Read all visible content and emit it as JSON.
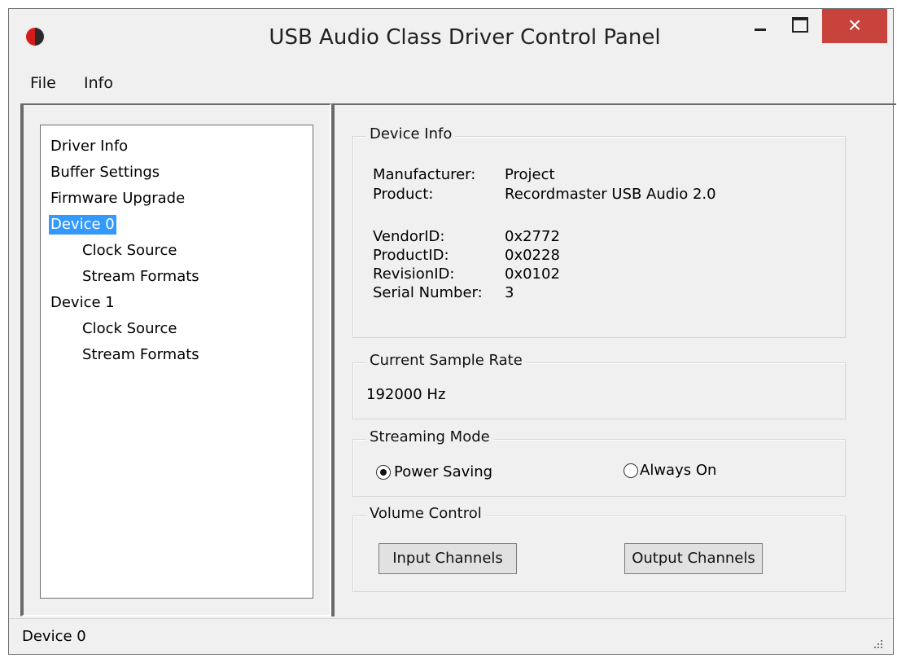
{
  "window": {
    "title": "USB Audio Class Driver Control Panel"
  },
  "titlebar_buttons": {
    "close": "×"
  },
  "menu": [
    "File",
    "Info"
  ],
  "tree": {
    "items": [
      {
        "label": "Driver Info",
        "level": 0,
        "selected": false
      },
      {
        "label": "Buffer Settings",
        "level": 0,
        "selected": false
      },
      {
        "label": "Firmware Upgrade",
        "level": 0,
        "selected": false
      },
      {
        "label": "Device 0",
        "level": 0,
        "selected": true
      },
      {
        "label": "Clock Source",
        "level": 1,
        "selected": false
      },
      {
        "label": "Stream Formats",
        "level": 1,
        "selected": false
      },
      {
        "label": "Device 1",
        "level": 0,
        "selected": false
      },
      {
        "label": "Clock Source",
        "level": 1,
        "selected": false
      },
      {
        "label": "Stream Formats",
        "level": 1,
        "selected": false
      }
    ]
  },
  "device_info": {
    "title": "Device Info",
    "rows": [
      {
        "label": "Manufacturer:",
        "value": "Project"
      },
      {
        "label": "Product:",
        "value": "Recordmaster USB Audio 2.0"
      },
      {
        "label": "VendorID:",
        "value": "0x2772"
      },
      {
        "label": "ProductID:",
        "value": "0x0228"
      },
      {
        "label": "RevisionID:",
        "value": "0x0102"
      },
      {
        "label": "Serial Number:",
        "value": "3"
      }
    ]
  },
  "sample_rate": {
    "title": "Current Sample Rate",
    "value": "192000 Hz"
  },
  "streaming_mode": {
    "title": "Streaming Mode",
    "options": [
      {
        "label": "Power Saving",
        "checked": true
      },
      {
        "label": "Always On",
        "checked": false
      }
    ]
  },
  "volume_control": {
    "title": "Volume Control",
    "input_button": "Input Channels",
    "output_button": "Output Channels"
  },
  "status": {
    "text": "Device 0"
  },
  "colors": {
    "selection": "#3399ff",
    "close_button": "#c7433b"
  }
}
